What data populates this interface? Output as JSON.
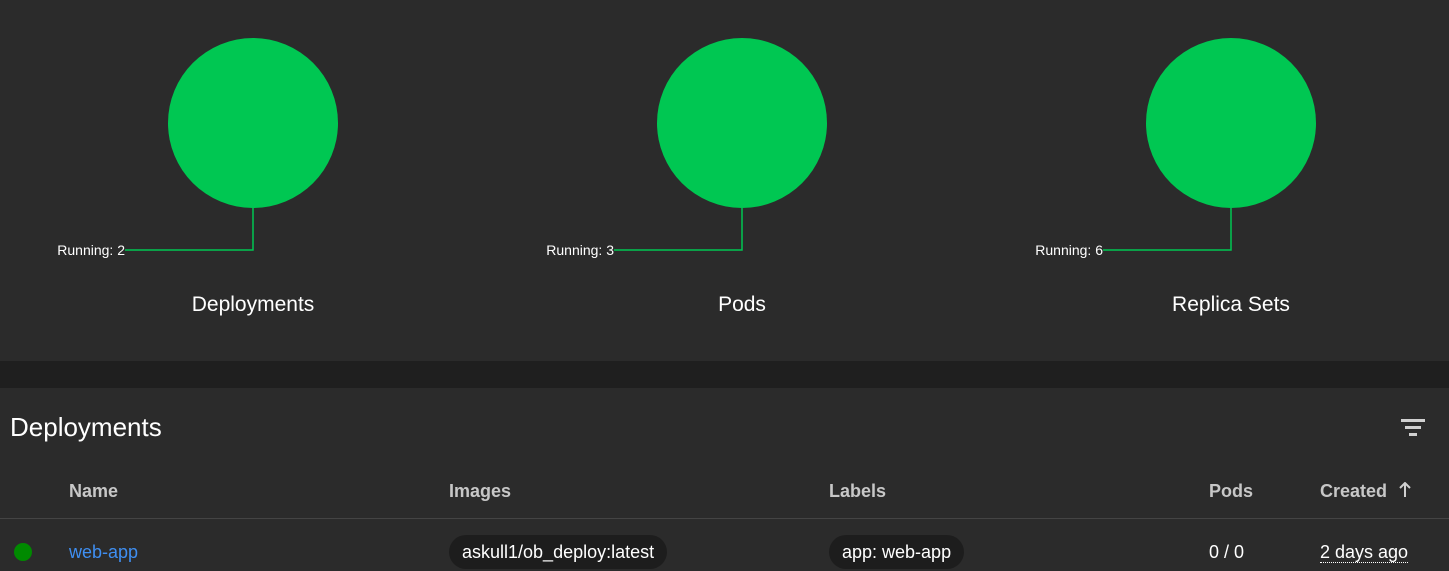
{
  "workload_status": {
    "charts": [
      {
        "title": "Deployments",
        "running_label": "Running: 2",
        "running": 2,
        "color": "#00c752"
      },
      {
        "title": "Pods",
        "running_label": "Running: 3",
        "running": 3,
        "color": "#00c752"
      },
      {
        "title": "Replica Sets",
        "running_label": "Running: 6",
        "running": 6,
        "color": "#00c752"
      }
    ]
  },
  "chart_data": [
    {
      "type": "pie",
      "title": "Deployments",
      "slices": [
        {
          "label": "Running",
          "value": 2,
          "color": "#00c752"
        }
      ]
    },
    {
      "type": "pie",
      "title": "Pods",
      "slices": [
        {
          "label": "Running",
          "value": 3,
          "color": "#00c752"
        }
      ]
    },
    {
      "type": "pie",
      "title": "Replica Sets",
      "slices": [
        {
          "label": "Running",
          "value": 6,
          "color": "#00c752"
        }
      ]
    }
  ],
  "deployments_card": {
    "title": "Deployments",
    "filter_icon": "filter-list-icon",
    "columns": {
      "name": "Name",
      "images": "Images",
      "labels": "Labels",
      "pods": "Pods",
      "created": "Created",
      "sort_icon": "arrow-up-icon"
    },
    "rows": [
      {
        "status_color": "#008a00",
        "name": "web-app",
        "image": "askull1/ob_deploy:latest",
        "label": "app: web-app",
        "pods": "0 / 0",
        "created": "2 days ago"
      }
    ]
  }
}
